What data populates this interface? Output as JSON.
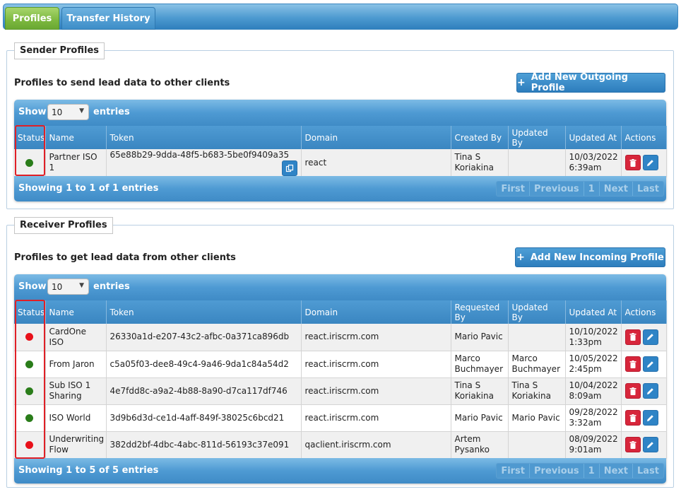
{
  "tabs": [
    {
      "label": "Profiles",
      "active": true
    },
    {
      "label": "Transfer History",
      "active": false
    }
  ],
  "sender": {
    "legend": "Sender Profiles",
    "title": "Profiles to send lead data to other clients",
    "add_button": "Add New Outgoing Profile",
    "show_label": "Show",
    "entries_value": "10",
    "entries_label": "entries",
    "columns": [
      "Status",
      "Name",
      "Token",
      "Domain",
      "Created By",
      "Updated By",
      "Updated At",
      "Actions"
    ],
    "rows": [
      {
        "status": "green",
        "name": "Partner ISO 1",
        "token": "65e88b29-9dda-48f5-b683-5be0f9409a35",
        "domain": "react",
        "by": "Tina S Koriakina",
        "updated_by": "",
        "updated_at": "10/03/2022 6:39am"
      }
    ],
    "info": "Showing 1 to 1 of 1 entries",
    "pager": [
      "First",
      "Previous",
      "1",
      "Next",
      "Last"
    ]
  },
  "receiver": {
    "legend": "Receiver Profiles",
    "title": "Profiles to get lead data from other clients",
    "add_button": "Add New Incoming Profile",
    "show_label": "Show",
    "entries_value": "10",
    "entries_label": "entries",
    "columns": [
      "Status",
      "Name",
      "Token",
      "Domain",
      "Requested By",
      "Updated By",
      "Updated At",
      "Actions"
    ],
    "rows": [
      {
        "status": "red",
        "name": "CardOne ISO",
        "token": "26330a1d-e207-43c2-afbc-0a371ca896db",
        "domain": "react.iriscrm.com",
        "by": "Mario Pavic",
        "updated_by": "",
        "updated_at": "10/10/2022 1:33pm"
      },
      {
        "status": "green",
        "name": "From Jaron",
        "token": "c5a05f03-dee8-49c4-9a46-9da1c84a54d2",
        "domain": "react.iriscrm.com",
        "by": "Marco Buchmayer",
        "updated_by": "Marco Buchmayer",
        "updated_at": "10/05/2022 2:45pm"
      },
      {
        "status": "green",
        "name": "Sub ISO 1 Sharing",
        "token": "4e7fdd8c-a9a2-4b88-8a90-d7ca117df746",
        "domain": "react.iriscrm.com",
        "by": "Tina S Koriakina",
        "updated_by": "Tina S Koriakina",
        "updated_at": "10/04/2022 8:09am"
      },
      {
        "status": "green",
        "name": "ISO World",
        "token": "3d9b6d3d-ce1d-4aff-849f-38025c6bcd21",
        "domain": "react.iriscrm.com",
        "by": "Mario Pavic",
        "updated_by": "Mario Pavic",
        "updated_at": "09/28/2022 3:32am"
      },
      {
        "status": "red",
        "name": "Underwriting Flow",
        "token": "382dd2bf-4dbc-4abc-811d-56193c37e091",
        "domain": "qaclient.iriscrm.com",
        "by": "Artem Pysanko",
        "updated_by": "",
        "updated_at": "08/09/2022 9:01am"
      }
    ],
    "info": "Showing 1 to 5 of 5 entries",
    "pager": [
      "First",
      "Previous",
      "1",
      "Next",
      "Last"
    ]
  },
  "colors": {
    "status_active": "#2a7d1a",
    "status_inactive": "#e8111a",
    "tab_active": "#7cb83f",
    "header_blue": "#3a86c1",
    "highlight": "#e01f26"
  }
}
